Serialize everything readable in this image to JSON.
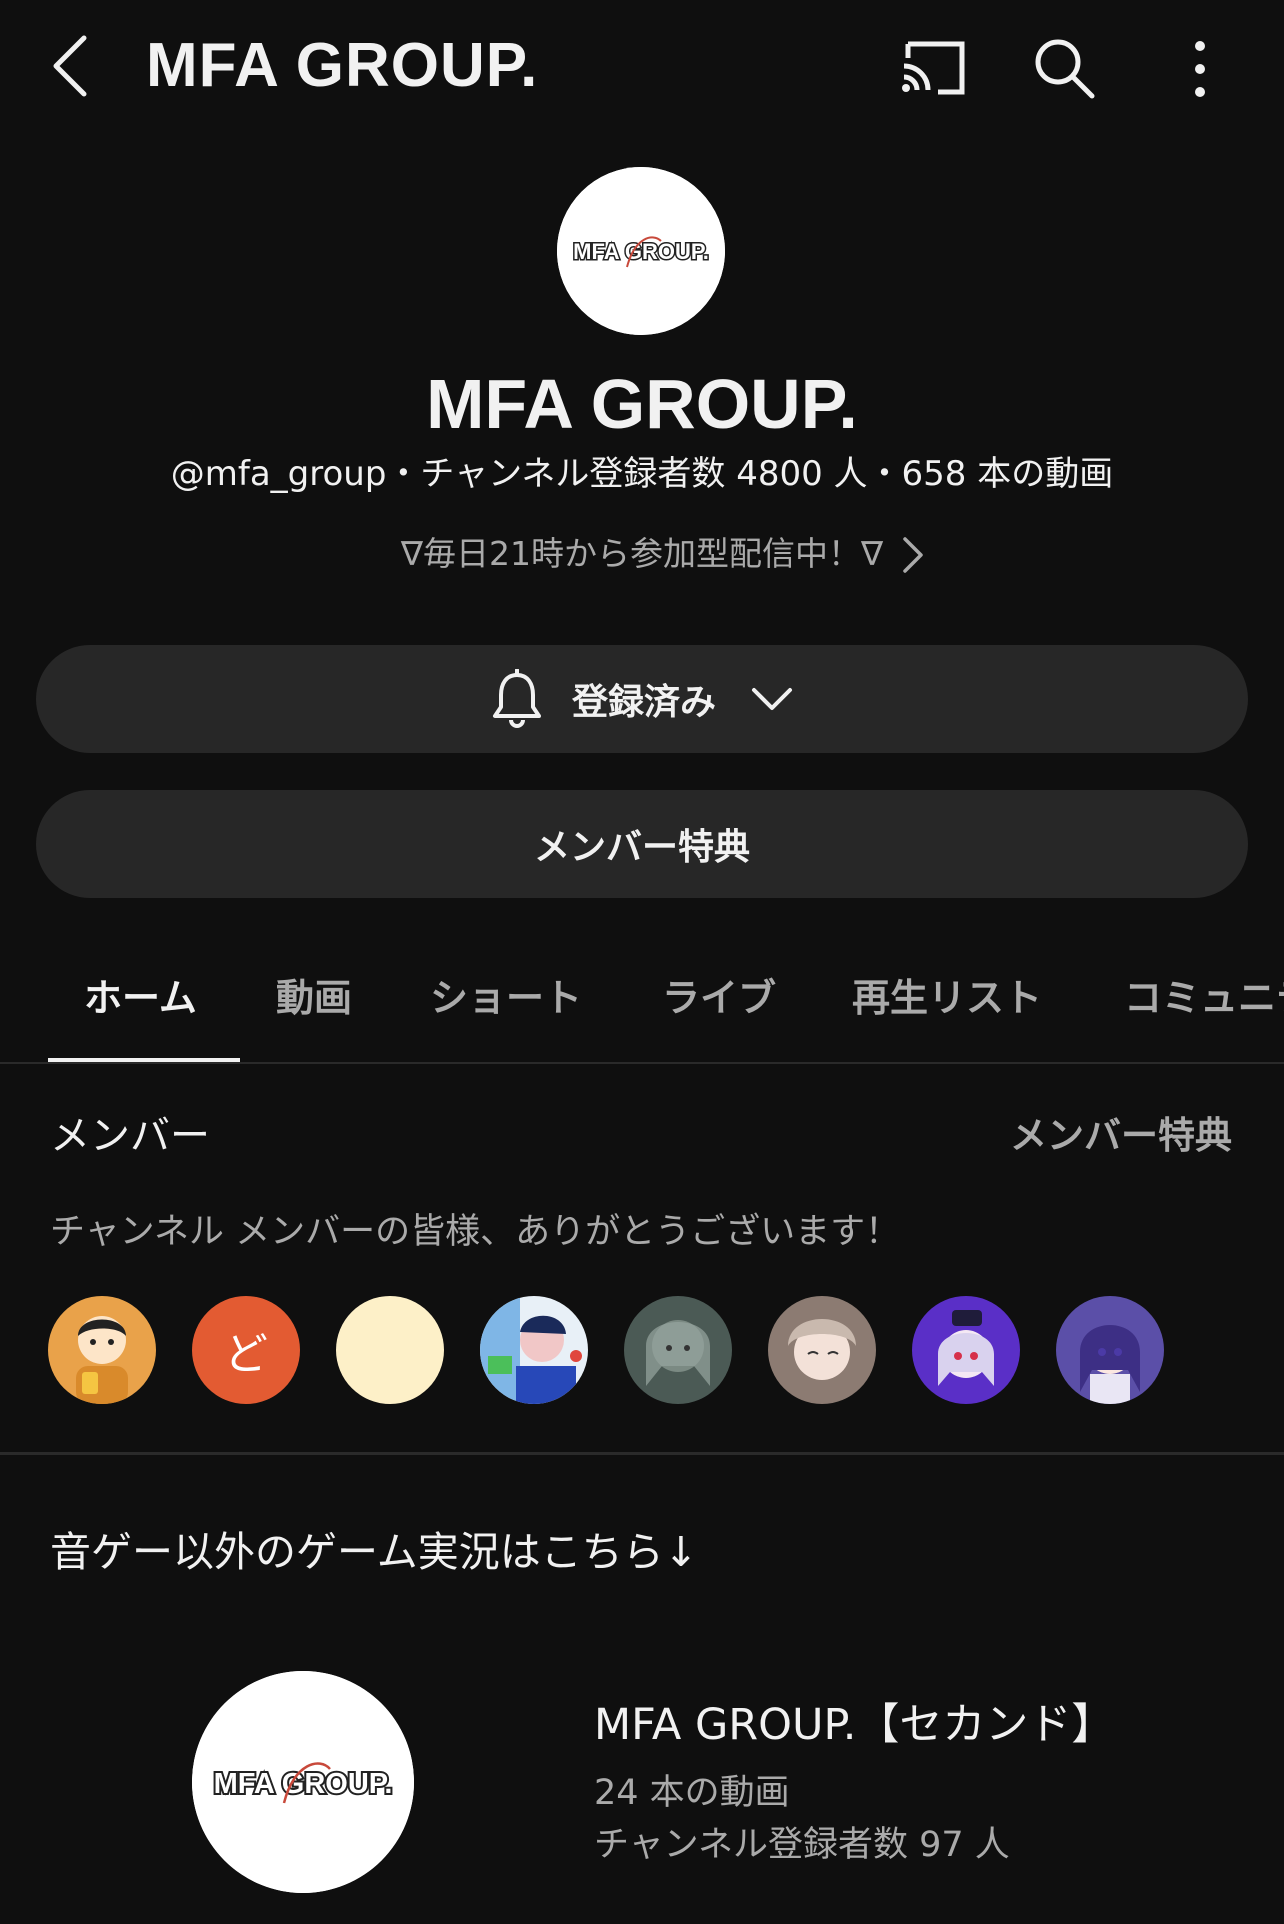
{
  "topbar": {
    "title": "MFA GROUP."
  },
  "channel": {
    "logo_text": "MFA GROUP.",
    "name": "MFA GROUP.",
    "meta": "@mfa_group・チャンネル登録者数 4800 人・658 本の動画",
    "description": "∇毎日21時から参加型配信中！∇"
  },
  "buttons": {
    "subscribe_label": "登録済み",
    "member_perk_label": "メンバー特典"
  },
  "tabs": [
    {
      "label": "ホーム",
      "active": true
    },
    {
      "label": "動画"
    },
    {
      "label": "ショート"
    },
    {
      "label": "ライブ"
    },
    {
      "label": "再生リスト"
    },
    {
      "label": "コミュニティ"
    }
  ],
  "members": {
    "heading": "メンバー",
    "link_label": "メンバー特典",
    "thanks": "チャンネル メンバーの皆様、ありがとうございます！",
    "avatars": [
      {
        "kind": "illustration",
        "bg": "#e9a24a"
      },
      {
        "kind": "letter",
        "letter": "ど",
        "bg": "#e35b32"
      },
      {
        "kind": "plain",
        "bg": "#fdf0c8"
      },
      {
        "kind": "illustration",
        "bg": "#3a66d6"
      },
      {
        "kind": "illustration",
        "bg": "#4b5a55"
      },
      {
        "kind": "illustration",
        "bg": "#8c7b72"
      },
      {
        "kind": "illustration",
        "bg": "#5a2fc7"
      },
      {
        "kind": "illustration",
        "bg": "#5b4fa8"
      }
    ]
  },
  "featured": {
    "heading": "音ゲー以外のゲーム実況はこちら↓",
    "logo_text": "MFA GROUP.",
    "name": "MFA GROUP.【セカンド】",
    "videos": "24 本の動画",
    "subscribers": "チャンネル登録者数 97 人"
  },
  "colors": {
    "background": "#0f0f0f",
    "pill": "#272727",
    "text_primary": "#f1f1f1",
    "text_secondary": "#aaaaaa"
  }
}
